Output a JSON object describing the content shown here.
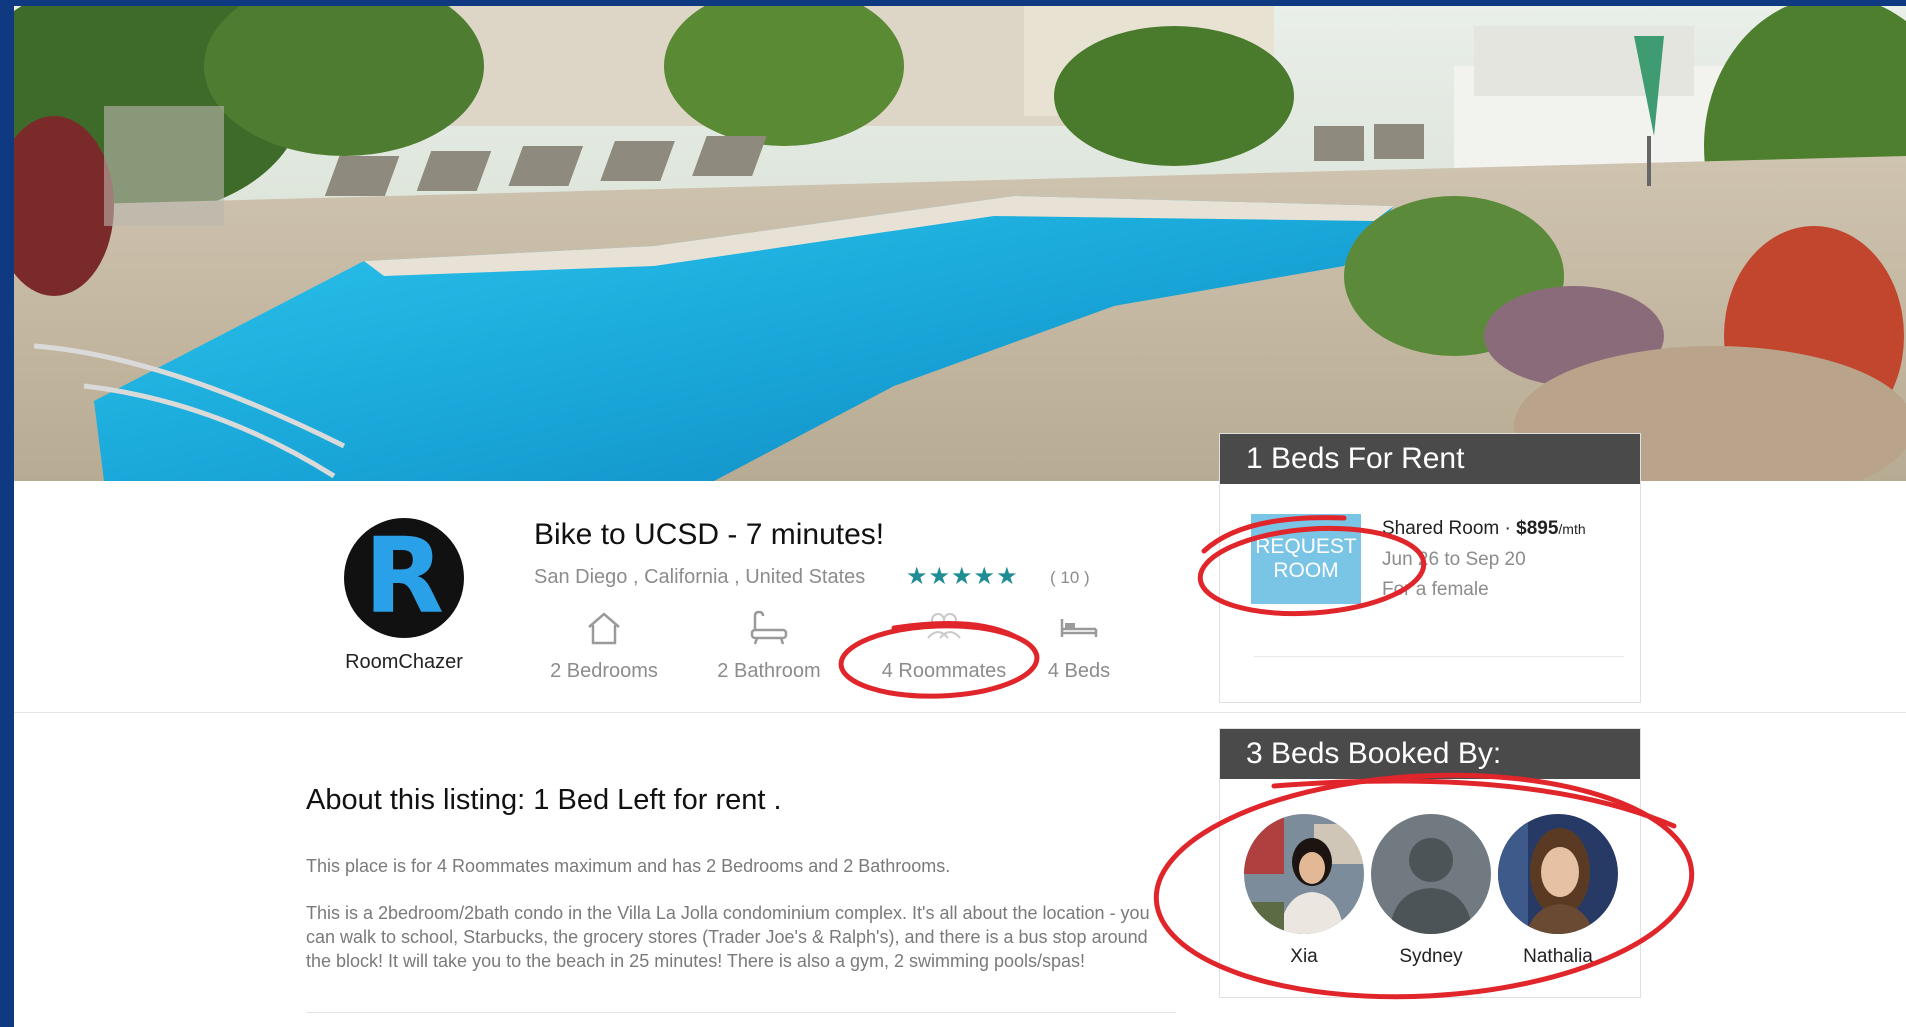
{
  "listing": {
    "title": "Bike to UCSD - 7 minutes!",
    "location": "San Diego , California , United States",
    "rating_stars": "★★★★★",
    "rating": 4.5,
    "review_count": "( 10 )"
  },
  "host": {
    "logo_letter": "R",
    "name": "RoomChazer"
  },
  "features": [
    {
      "icon": "house-icon",
      "label": "2 Bedrooms"
    },
    {
      "icon": "bathtub-icon",
      "label": "2 Bathroom"
    },
    {
      "icon": "roommates-icon",
      "label": "4 Roommates"
    },
    {
      "icon": "bed-icon",
      "label": "4 Beds"
    }
  ],
  "rent_panel": {
    "header": "1 Beds For Rent",
    "request_button": {
      "line1": "REQUEST",
      "line2": "ROOM"
    },
    "room_type": "Shared Room · ",
    "price": "$895",
    "price_unit": "/mth",
    "dates": "Jun 26 to Sep 20",
    "for": "For a female"
  },
  "booked_panel": {
    "header": "3 Beds Booked By:",
    "roommates": [
      {
        "name": "Xia"
      },
      {
        "name": "Sydney"
      },
      {
        "name": "Nathalia"
      }
    ]
  },
  "about": {
    "title": "About this listing: 1 Bed Left for rent .",
    "summary": "This place is for 4 Roommates maximum and has 2 Bedrooms and 2 Bathrooms.",
    "description": "This is a 2bedroom/2bath condo in the Villa La Jolla condominium complex. It's all about the location - you can walk to school, Starbucks, the grocery stores (Trader Joe's & Ralph's), and there is a bus stop around the block! It will take you to the beach in 25 minutes! There is also a gym, 2 swimming pools/spas!"
  },
  "colors": {
    "accent_star": "#1f8d93",
    "request_button": "#7ac4e6",
    "panel_header": "#4a4a4a",
    "annotation": "#e0262b",
    "frame": "#0f3a82"
  }
}
